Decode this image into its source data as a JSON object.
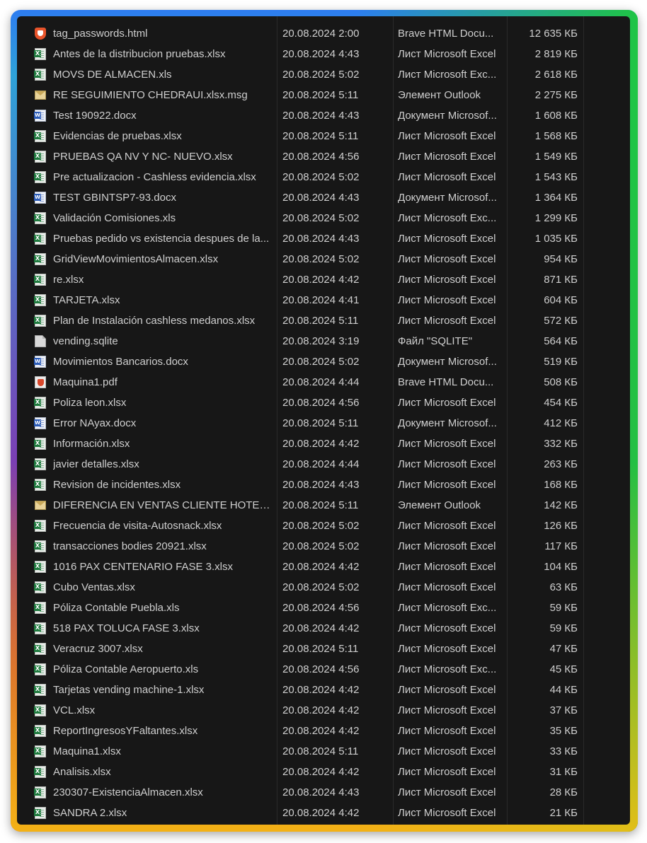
{
  "colors": {
    "window_bg": "#171717",
    "text": "#cfcfcf"
  },
  "files": [
    {
      "name": "tag_passwords.html",
      "date": "20.08.2024 2:00",
      "type": "Brave HTML Docu...",
      "size": "12 635 КБ",
      "icon": "brave-html-icon"
    },
    {
      "name": "Antes de la distribucion pruebas.xlsx",
      "date": "20.08.2024 4:43",
      "type": "Лист Microsoft Excel",
      "size": "2 819 КБ",
      "icon": "excel-file-icon"
    },
    {
      "name": "MOVS DE ALMACEN.xls",
      "date": "20.08.2024 5:02",
      "type": "Лист Microsoft Exc...",
      "size": "2 618 КБ",
      "icon": "excel-file-icon"
    },
    {
      "name": "RE SEGUIMIENTO CHEDRAUI.xlsx.msg",
      "date": "20.08.2024 5:11",
      "type": "Элемент Outlook",
      "size": "2 275 КБ",
      "icon": "outlook-message-icon"
    },
    {
      "name": "Test 190922.docx",
      "date": "20.08.2024 4:43",
      "type": "Документ Microsof...",
      "size": "1 608 КБ",
      "icon": "word-file-icon"
    },
    {
      "name": "Evidencias de pruebas.xlsx",
      "date": "20.08.2024 5:11",
      "type": "Лист Microsoft Excel",
      "size": "1 568 КБ",
      "icon": "excel-file-icon"
    },
    {
      "name": "PRUEBAS QA NV Y NC- NUEVO.xlsx",
      "date": "20.08.2024 4:56",
      "type": "Лист Microsoft Excel",
      "size": "1 549 КБ",
      "icon": "excel-file-icon"
    },
    {
      "name": "Pre actualizacion - Cashless evidencia.xlsx",
      "date": "20.08.2024 5:02",
      "type": "Лист Microsoft Excel",
      "size": "1 543 КБ",
      "icon": "excel-file-icon"
    },
    {
      "name": "TEST GBINTSP7-93.docx",
      "date": "20.08.2024 4:43",
      "type": "Документ Microsof...",
      "size": "1 364 КБ",
      "icon": "word-file-icon"
    },
    {
      "name": "Validación Comisiones.xls",
      "date": "20.08.2024 5:02",
      "type": "Лист Microsoft Exc...",
      "size": "1 299 КБ",
      "icon": "excel-file-icon"
    },
    {
      "name": "Pruebas pedido vs existencia despues de la...",
      "date": "20.08.2024 4:43",
      "type": "Лист Microsoft Excel",
      "size": "1 035 КБ",
      "icon": "excel-file-icon"
    },
    {
      "name": "GridViewMovimientosAlmacen.xlsx",
      "date": "20.08.2024 5:02",
      "type": "Лист Microsoft Excel",
      "size": "954 КБ",
      "icon": "excel-file-icon"
    },
    {
      "name": "re.xlsx",
      "date": "20.08.2024 4:42",
      "type": "Лист Microsoft Excel",
      "size": "871 КБ",
      "icon": "excel-file-icon"
    },
    {
      "name": "TARJETA.xlsx",
      "date": "20.08.2024 4:41",
      "type": "Лист Microsoft Excel",
      "size": "604 КБ",
      "icon": "excel-file-icon"
    },
    {
      "name": "Plan de Instalación cashless medanos.xlsx",
      "date": "20.08.2024 5:11",
      "type": "Лист Microsoft Excel",
      "size": "572 КБ",
      "icon": "excel-file-icon"
    },
    {
      "name": "vending.sqlite",
      "date": "20.08.2024 3:19",
      "type": "Файл \"SQLITE\"",
      "size": "564 КБ",
      "icon": "generic-file-icon"
    },
    {
      "name": "Movimientos Bancarios.docx",
      "date": "20.08.2024 5:02",
      "type": "Документ Microsof...",
      "size": "519 КБ",
      "icon": "word-file-icon"
    },
    {
      "name": "Maquina1.pdf",
      "date": "20.08.2024 4:44",
      "type": "Brave HTML Docu...",
      "size": "508 КБ",
      "icon": "pdf-file-icon"
    },
    {
      "name": "Poliza leon.xlsx",
      "date": "20.08.2024 4:56",
      "type": "Лист Microsoft Excel",
      "size": "454 КБ",
      "icon": "excel-file-icon"
    },
    {
      "name": "Error NAyax.docx",
      "date": "20.08.2024 5:11",
      "type": "Документ Microsof...",
      "size": "412 КБ",
      "icon": "word-file-icon"
    },
    {
      "name": "Información.xlsx",
      "date": "20.08.2024 4:42",
      "type": "Лист Microsoft Excel",
      "size": "332 КБ",
      "icon": "excel-file-icon"
    },
    {
      "name": "javier detalles.xlsx",
      "date": "20.08.2024 4:44",
      "type": "Лист Microsoft Excel",
      "size": "263 КБ",
      "icon": "excel-file-icon"
    },
    {
      "name": "Revision de incidentes.xlsx",
      "date": "20.08.2024 4:43",
      "type": "Лист Microsoft Excel",
      "size": "168 КБ",
      "icon": "excel-file-icon"
    },
    {
      "name": "DIFERENCIA EN VENTAS CLIENTE HOTELE...",
      "date": "20.08.2024 5:11",
      "type": "Элемент Outlook",
      "size": "142 КБ",
      "icon": "outlook-message-icon"
    },
    {
      "name": "Frecuencia de visita-Autosnack.xlsx",
      "date": "20.08.2024 5:02",
      "type": "Лист Microsoft Excel",
      "size": "126 КБ",
      "icon": "excel-file-icon"
    },
    {
      "name": "transacciones bodies 20921.xlsx",
      "date": "20.08.2024 5:02",
      "type": "Лист Microsoft Excel",
      "size": "117 КБ",
      "icon": "excel-file-icon"
    },
    {
      "name": "1016 PAX CENTENARIO FASE 3.xlsx",
      "date": "20.08.2024 4:42",
      "type": "Лист Microsoft Excel",
      "size": "104 КБ",
      "icon": "excel-file-icon"
    },
    {
      "name": "Cubo Ventas.xlsx",
      "date": "20.08.2024 5:02",
      "type": "Лист Microsoft Excel",
      "size": "63 КБ",
      "icon": "excel-file-icon"
    },
    {
      "name": "Póliza Contable Puebla.xls",
      "date": "20.08.2024 4:56",
      "type": "Лист Microsoft Exc...",
      "size": "59 КБ",
      "icon": "excel-file-icon"
    },
    {
      "name": "518 PAX TOLUCA FASE 3.xlsx",
      "date": "20.08.2024 4:42",
      "type": "Лист Microsoft Excel",
      "size": "59 КБ",
      "icon": "excel-file-icon"
    },
    {
      "name": "Veracruz 3007.xlsx",
      "date": "20.08.2024 5:11",
      "type": "Лист Microsoft Excel",
      "size": "47 КБ",
      "icon": "excel-file-icon"
    },
    {
      "name": "Póliza Contable Aeropuerto.xls",
      "date": "20.08.2024 4:56",
      "type": "Лист Microsoft Exc...",
      "size": "45 КБ",
      "icon": "excel-file-icon"
    },
    {
      "name": "Tarjetas vending machine-1.xlsx",
      "date": "20.08.2024 4:42",
      "type": "Лист Microsoft Excel",
      "size": "44 КБ",
      "icon": "excel-file-icon"
    },
    {
      "name": "VCL.xlsx",
      "date": "20.08.2024 4:42",
      "type": "Лист Microsoft Excel",
      "size": "37 КБ",
      "icon": "excel-file-icon"
    },
    {
      "name": "ReportIngresosYFaltantes.xlsx",
      "date": "20.08.2024 4:42",
      "type": "Лист Microsoft Excel",
      "size": "35 КБ",
      "icon": "excel-file-icon"
    },
    {
      "name": "Maquina1.xlsx",
      "date": "20.08.2024 5:11",
      "type": "Лист Microsoft Excel",
      "size": "33 КБ",
      "icon": "excel-file-icon"
    },
    {
      "name": "Analisis.xlsx",
      "date": "20.08.2024 4:42",
      "type": "Лист Microsoft Excel",
      "size": "31 КБ",
      "icon": "excel-file-icon"
    },
    {
      "name": "230307-ExistenciaAlmacen.xlsx",
      "date": "20.08.2024 4:43",
      "type": "Лист Microsoft Excel",
      "size": "28 КБ",
      "icon": "excel-file-icon"
    },
    {
      "name": "SANDRA 2.xlsx",
      "date": "20.08.2024 4:42",
      "type": "Лист Microsoft Excel",
      "size": "21 КБ",
      "icon": "excel-file-icon"
    }
  ]
}
